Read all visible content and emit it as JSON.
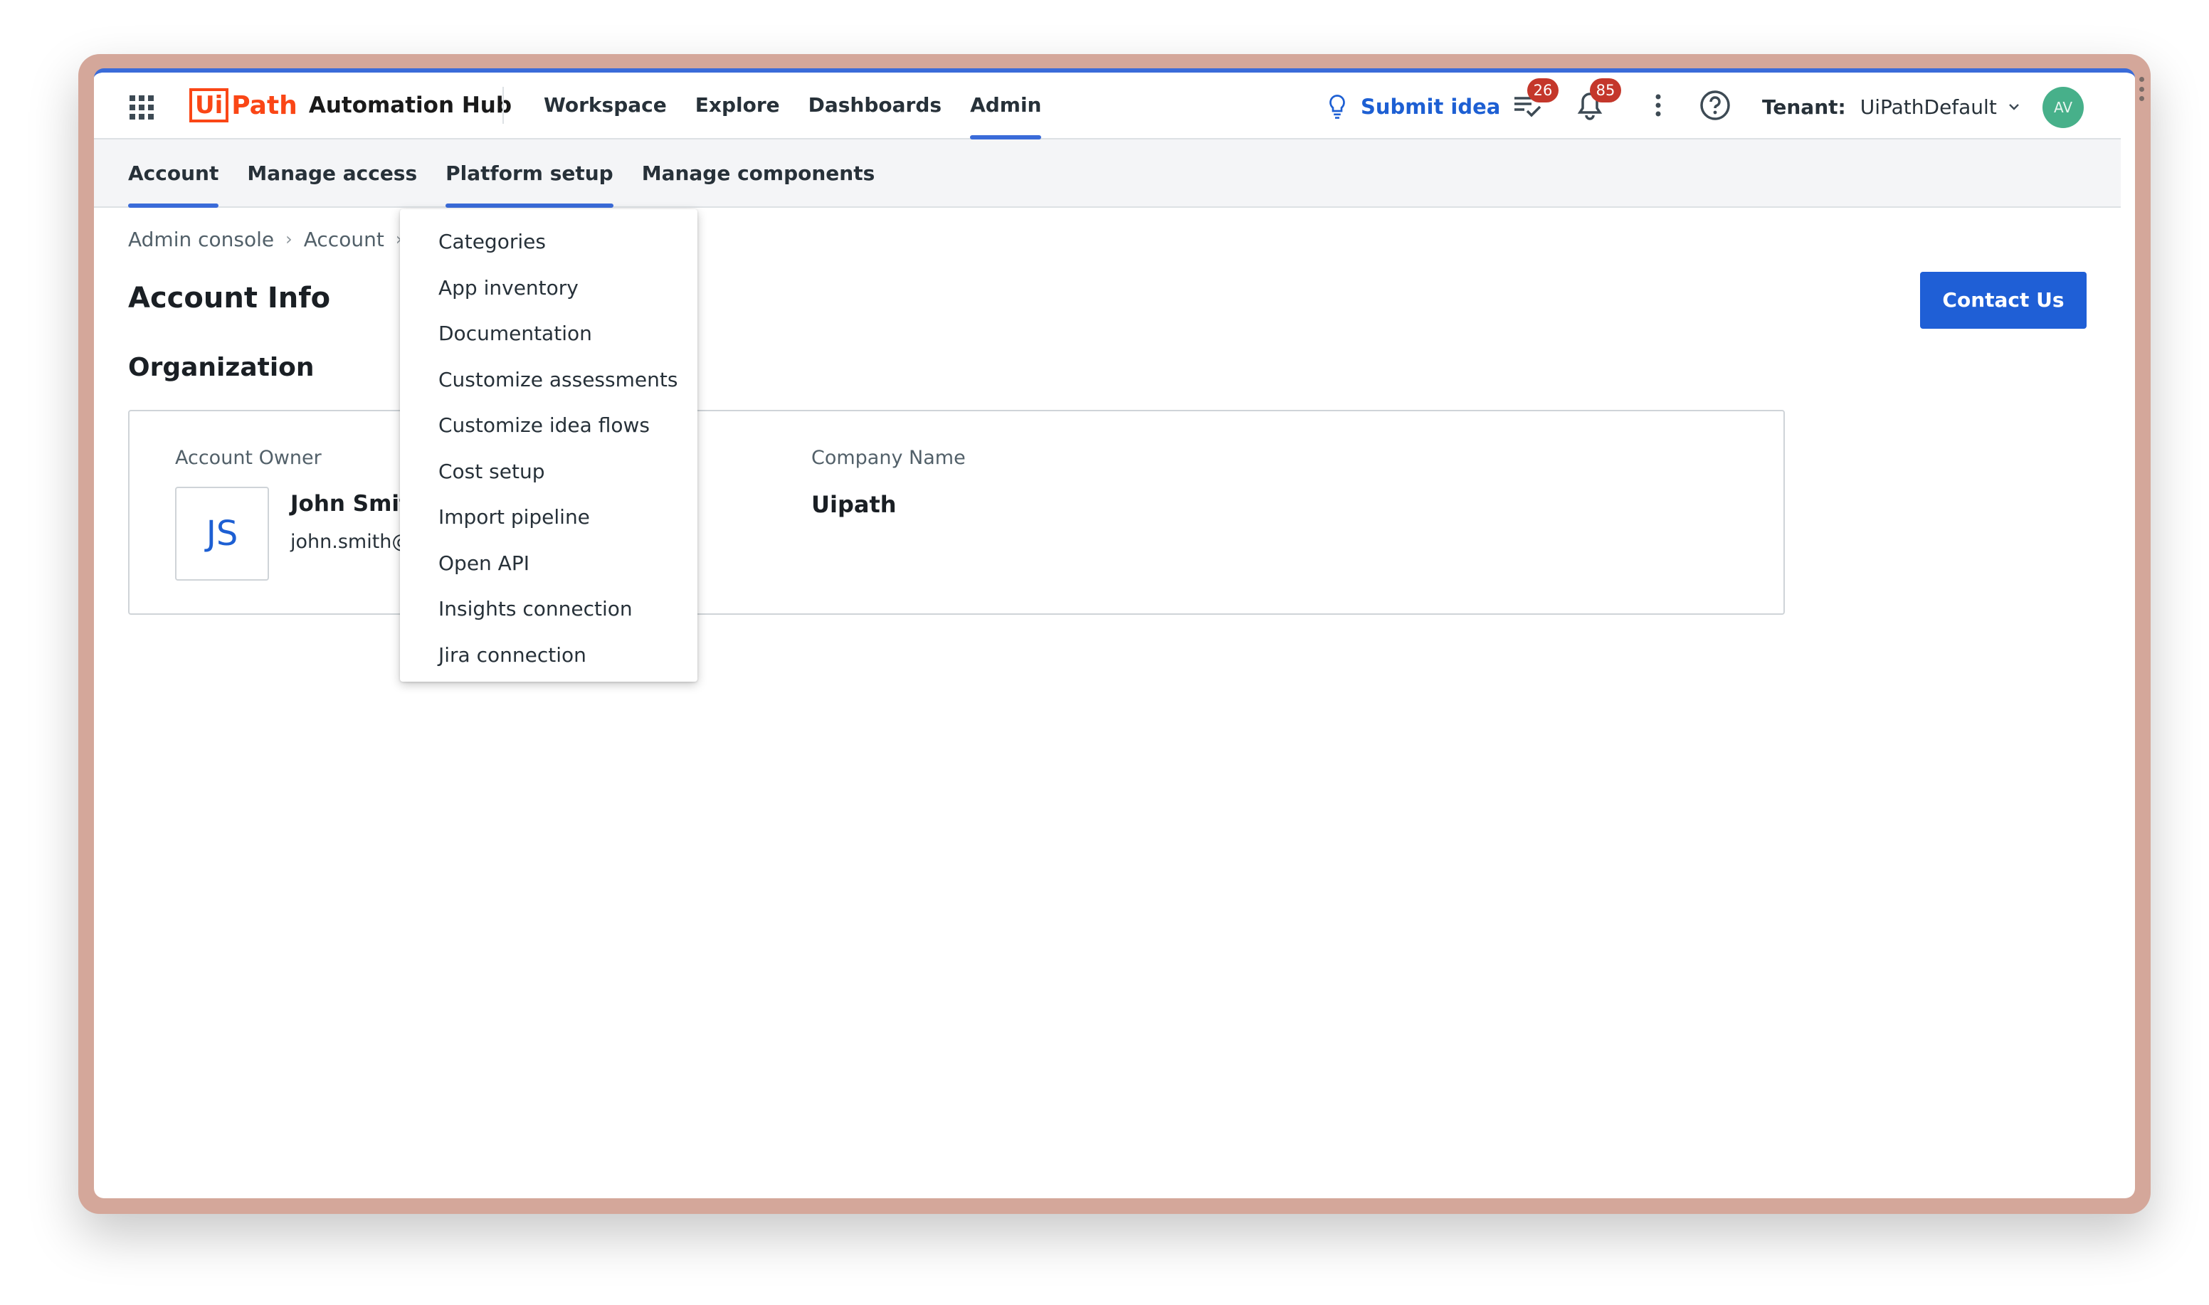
{
  "app": {
    "logo_mark": "Ui",
    "logo_path": "Path",
    "product_name": "Automation Hub"
  },
  "nav": {
    "items": [
      {
        "label": "Workspace",
        "active": false
      },
      {
        "label": "Explore",
        "active": false
      },
      {
        "label": "Dashboards",
        "active": false
      },
      {
        "label": "Admin",
        "active": true
      }
    ]
  },
  "header": {
    "submit_idea": "Submit idea",
    "tasks_badge": "26",
    "notifications_badge": "85",
    "tenant_label": "Tenant:",
    "tenant_value": "UiPathDefault",
    "avatar_initials": "AV"
  },
  "subnav": {
    "items": [
      {
        "label": "Account",
        "active": true
      },
      {
        "label": "Manage access",
        "active": false
      },
      {
        "label": "Platform setup",
        "active": false
      },
      {
        "label": "Manage components",
        "active": false
      }
    ]
  },
  "breadcrumb": {
    "items": [
      "Admin console",
      "Account"
    ]
  },
  "page": {
    "title": "Account Info",
    "contact_button": "Contact Us",
    "section_title": "Organization"
  },
  "organization": {
    "owner_label": "Account Owner",
    "owner_initials": "JS",
    "owner_name": "John Smit",
    "owner_email": "john.smith@",
    "company_label": "Company Name",
    "company_name": "Uipath"
  },
  "dropdown": {
    "items": [
      "Categories",
      "App inventory",
      "Documentation",
      "Customize assessments",
      "Customize idea flows",
      "Cost setup",
      "Import pipeline",
      "Open API",
      "Insights connection",
      "Jira connection"
    ]
  },
  "colors": {
    "accent": "#3a6bd9",
    "primary_button": "#1f5fd6",
    "badge": "#c4372b",
    "brand": "#fa4616",
    "avatar": "#47b08a"
  }
}
